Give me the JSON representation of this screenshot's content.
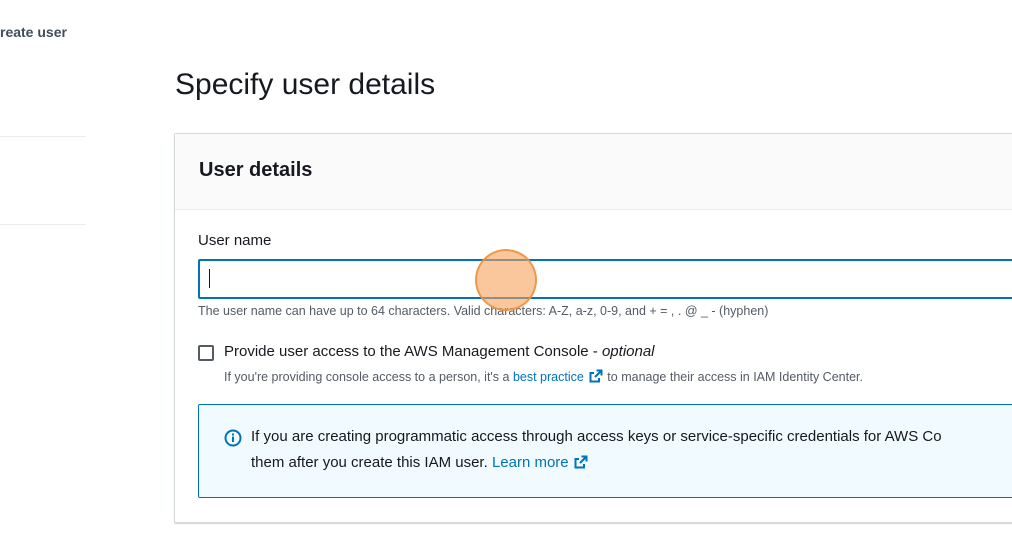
{
  "breadcrumb": {
    "current": "reate user"
  },
  "page": {
    "title": "Specify user details"
  },
  "container": {
    "title": "User details"
  },
  "username": {
    "label": "User name",
    "value": "",
    "constraint": "The user name can have up to 64 characters. Valid characters: A-Z, a-z, 0-9, and + = , . @ _ - (hyphen)"
  },
  "console_access": {
    "label": "Provide user access to the AWS Management Console - ",
    "optional": "optional",
    "checked": false,
    "desc_prefix": "If you're providing console access to a person, it's a ",
    "desc_link": "best practice",
    "desc_suffix": " to manage their access in IAM Identity Center."
  },
  "info": {
    "line1": "If you are creating programmatic access through access keys or service-specific credentials for AWS Co",
    "line2_prefix": "them after you create this IAM user. ",
    "learn_more": "Learn more"
  },
  "icons": {
    "external": "external-link-icon",
    "info": "info-circle-icon"
  },
  "colors": {
    "link": "#0073bb",
    "input_focus_border": "#0073bb",
    "info_bg": "#f1faff",
    "click_marker": "#f7a05a"
  }
}
